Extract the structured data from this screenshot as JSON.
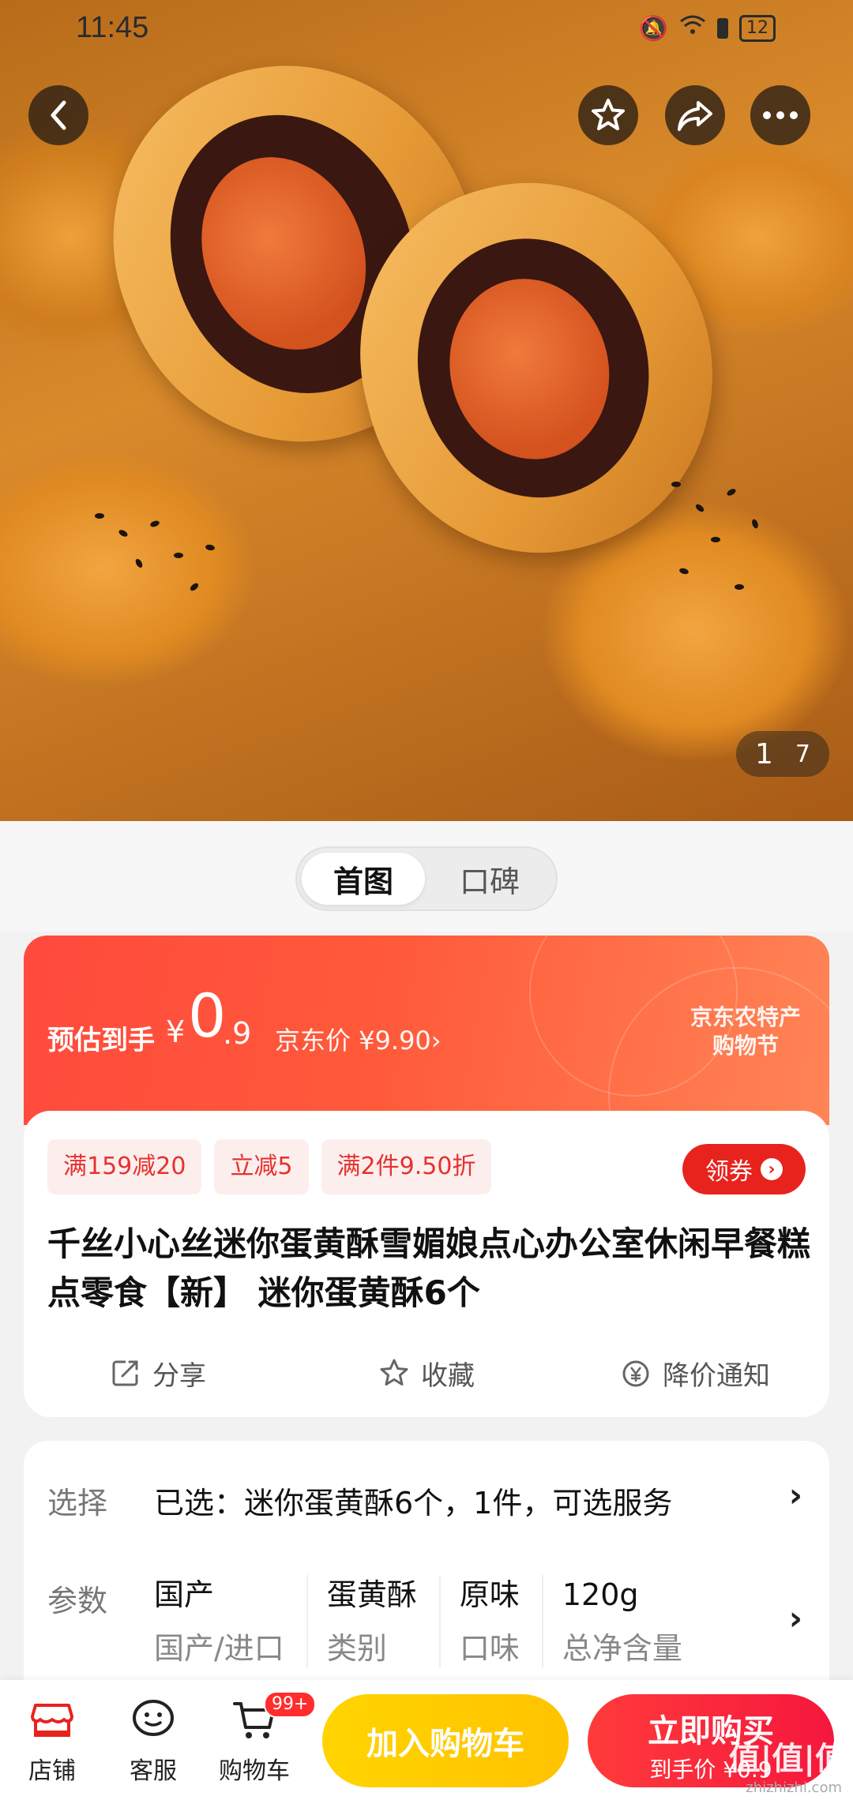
{
  "status_bar": {
    "time": "11:45",
    "battery": "12"
  },
  "gallery": {
    "current": "1",
    "total": "7"
  },
  "view_toggle": {
    "active": "首图",
    "inactive": "口碑"
  },
  "price": {
    "estimate_label": "预估到手",
    "currency": "¥",
    "estimate_int": "0",
    "estimate_dec": ".9",
    "jd_price_text": "京东价 ¥9.90›",
    "festival_line1": "京东农特产",
    "festival_line2": "购物节",
    "accent_color": "#ff4a3d"
  },
  "promo_tags": [
    "满159减20",
    "立减5",
    "满2件9.50折"
  ],
  "coupon_label": "领券",
  "product_title": "千丝小心丝迷你蛋黄酥雪媚娘点心办公室休闲早餐糕点零食【新】 迷你蛋黄酥6个",
  "actions": {
    "share": "分享",
    "favorite": "收藏",
    "price_alert": "降价通知"
  },
  "selection": {
    "label": "选择",
    "value": "已选：迷你蛋黄酥6个，1件，可选服务"
  },
  "params": {
    "label": "参数",
    "items": [
      {
        "value": "国产",
        "key": "国产/进口"
      },
      {
        "value": "蛋黄酥",
        "key": "类别"
      },
      {
        "value": "原味",
        "key": "口味"
      },
      {
        "value": "120g",
        "key": "总净含量"
      }
    ]
  },
  "bottom_nav": {
    "store": "店铺",
    "service": "客服",
    "cart": "购物车",
    "cart_badge": "99+",
    "add_to_cart": "加入购物车",
    "buy_now": "立即购买",
    "buy_now_sub": "到手价 ¥0.9"
  },
  "watermark": {
    "main": "值|值|值",
    "sub": "zhizhizhi.com"
  }
}
